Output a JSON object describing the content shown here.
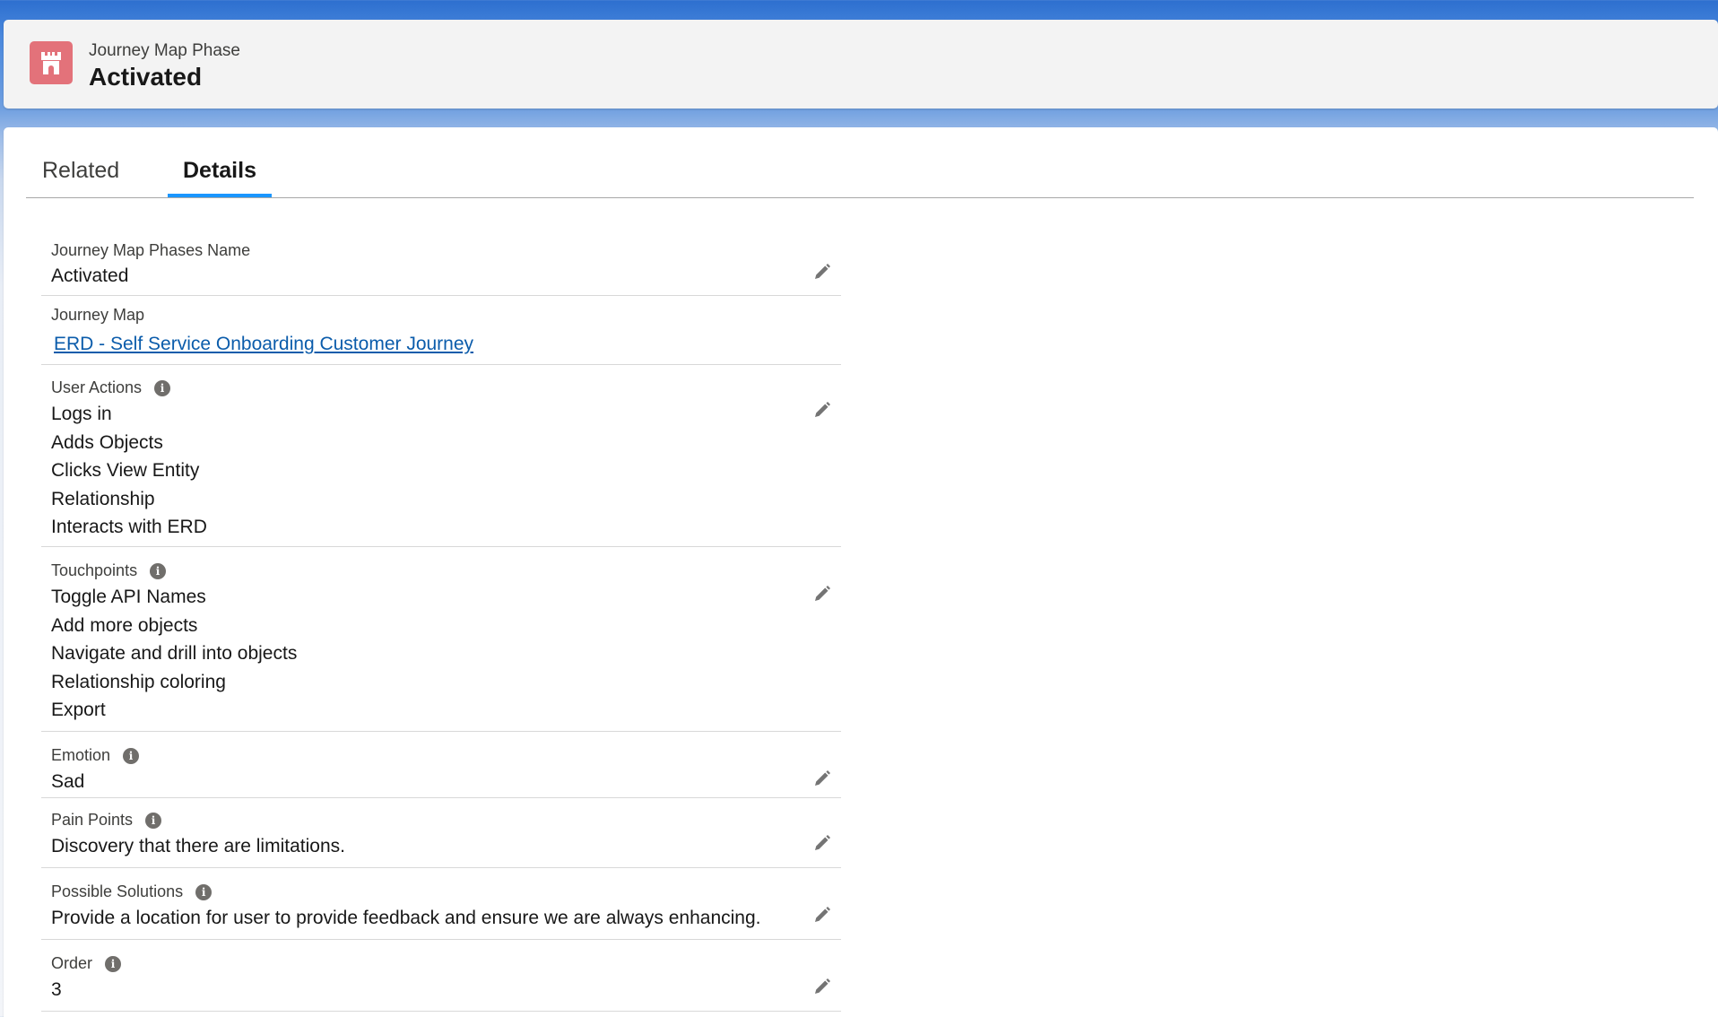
{
  "header": {
    "object_type": "Journey Map Phase",
    "record_name": "Activated",
    "icon": "castle-icon",
    "icon_color": "#e3727a"
  },
  "tabs": [
    {
      "label": "Related",
      "active": false
    },
    {
      "label": "Details",
      "active": true
    }
  ],
  "fields": {
    "name": {
      "label": "Journey Map Phases Name",
      "value": "Activated"
    },
    "journey_map": {
      "label": "Journey Map",
      "value": "ERD - Self Service Onboarding Customer Journey"
    },
    "user_actions": {
      "label": "User Actions",
      "values": [
        "Logs in",
        "Adds Objects",
        "Clicks View Entity",
        "Relationship",
        "Interacts with ERD"
      ]
    },
    "touchpoints": {
      "label": "Touchpoints",
      "values": [
        "Toggle API Names",
        "Add more objects",
        "Navigate and drill into objects",
        "Relationship coloring",
        "Export"
      ]
    },
    "emotion": {
      "label": "Emotion",
      "value": "Sad"
    },
    "pain_points": {
      "label": "Pain Points",
      "value": "Discovery that there are limitations."
    },
    "possible_solutions": {
      "label": "Possible Solutions",
      "value": "Provide a location for user to provide feedback and ensure we are always enhancing."
    },
    "order": {
      "label": "Order",
      "value": "3"
    }
  },
  "colors": {
    "accent": "#1b96ff",
    "link": "#0b5cab",
    "info_icon": "#706e6b"
  }
}
